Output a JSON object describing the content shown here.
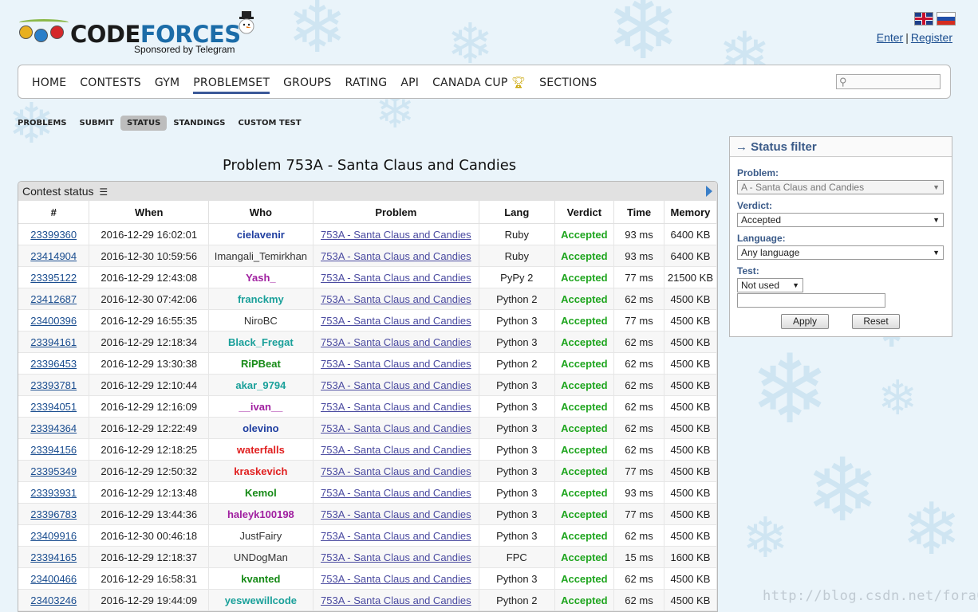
{
  "brand": {
    "wordmark_part1": "CODE",
    "wordmark_part2": "FORCES",
    "sponsor": "Sponsored by Telegram"
  },
  "auth": {
    "enter": "Enter",
    "separator": "|",
    "register": "Register"
  },
  "languages": [
    "english-flag-icon",
    "russian-flag-icon"
  ],
  "main_nav": [
    {
      "label": "HOME"
    },
    {
      "label": "CONTESTS"
    },
    {
      "label": "GYM"
    },
    {
      "label": "PROBLEMSET",
      "active": true
    },
    {
      "label": "GROUPS"
    },
    {
      "label": "RATING"
    },
    {
      "label": "API"
    },
    {
      "label": "CANADA CUP",
      "icon": "trophy-icon"
    },
    {
      "label": "SECTIONS"
    }
  ],
  "search": {
    "icon": "search-icon",
    "value": ""
  },
  "sub_nav": [
    {
      "label": "PROBLEMS"
    },
    {
      "label": "SUBMIT"
    },
    {
      "label": "STATUS",
      "active": true
    },
    {
      "label": "STANDINGS"
    },
    {
      "label": "CUSTOM TEST"
    }
  ],
  "page_title": "Problem 753A - Santa Claus and Candies",
  "status_box": {
    "title": "Contest status",
    "icon": "list-icon",
    "next_icon": "arrow-right-icon",
    "columns": [
      "#",
      "When",
      "Who",
      "Problem",
      "Lang",
      "Verdict",
      "Time",
      "Memory"
    ],
    "rows": [
      {
        "id": "23399360",
        "when": "2016-12-29 16:02:01",
        "who": "cielavenir",
        "who_color": "#1f3ea0",
        "problem": "753A - Santa Claus and Candies",
        "lang": "Ruby",
        "verdict": "Accepted",
        "time": "93 ms",
        "memory": "6400 KB"
      },
      {
        "id": "23414904",
        "when": "2016-12-30 10:59:56",
        "who": "Imangali_Temirkhan",
        "who_color": "#333333",
        "problem": "753A - Santa Claus and Candies",
        "lang": "Ruby",
        "verdict": "Accepted",
        "time": "93 ms",
        "memory": "6400 KB"
      },
      {
        "id": "23395122",
        "when": "2016-12-29 12:43:08",
        "who": "Yash_",
        "who_color": "#a01fa0",
        "problem": "753A - Santa Claus and Candies",
        "lang": "PyPy 2",
        "verdict": "Accepted",
        "time": "77 ms",
        "memory": "21500 KB"
      },
      {
        "id": "23412687",
        "when": "2016-12-30 07:42:06",
        "who": "franckmy",
        "who_color": "#1aa09a",
        "problem": "753A - Santa Claus and Candies",
        "lang": "Python 2",
        "verdict": "Accepted",
        "time": "62 ms",
        "memory": "4500 KB"
      },
      {
        "id": "23400396",
        "when": "2016-12-29 16:55:35",
        "who": "NiroBC",
        "who_color": "#333333",
        "problem": "753A - Santa Claus and Candies",
        "lang": "Python 3",
        "verdict": "Accepted",
        "time": "77 ms",
        "memory": "4500 KB"
      },
      {
        "id": "23394161",
        "when": "2016-12-29 12:18:34",
        "who": "Black_Fregat",
        "who_color": "#1aa09a",
        "problem": "753A - Santa Claus and Candies",
        "lang": "Python 3",
        "verdict": "Accepted",
        "time": "62 ms",
        "memory": "4500 KB"
      },
      {
        "id": "23396453",
        "when": "2016-12-29 13:30:38",
        "who": "RiPBeat",
        "who_color": "#168a16",
        "problem": "753A - Santa Claus and Candies",
        "lang": "Python 2",
        "verdict": "Accepted",
        "time": "62 ms",
        "memory": "4500 KB"
      },
      {
        "id": "23393781",
        "when": "2016-12-29 12:10:44",
        "who": "akar_9794",
        "who_color": "#1aa09a",
        "problem": "753A - Santa Claus and Candies",
        "lang": "Python 3",
        "verdict": "Accepted",
        "time": "62 ms",
        "memory": "4500 KB"
      },
      {
        "id": "23394051",
        "when": "2016-12-29 12:16:09",
        "who": "__ivan__",
        "who_color": "#a01fa0",
        "problem": "753A - Santa Claus and Candies",
        "lang": "Python 3",
        "verdict": "Accepted",
        "time": "62 ms",
        "memory": "4500 KB"
      },
      {
        "id": "23394364",
        "when": "2016-12-29 12:22:49",
        "who": "olevino",
        "who_color": "#1f3ea0",
        "problem": "753A - Santa Claus and Candies",
        "lang": "Python 3",
        "verdict": "Accepted",
        "time": "62 ms",
        "memory": "4500 KB"
      },
      {
        "id": "23394156",
        "when": "2016-12-29 12:18:25",
        "who": "waterfalls",
        "who_color": "#e01f1f",
        "problem": "753A - Santa Claus and Candies",
        "lang": "Python 3",
        "verdict": "Accepted",
        "time": "62 ms",
        "memory": "4500 KB"
      },
      {
        "id": "23395349",
        "when": "2016-12-29 12:50:32",
        "who": "kraskevich",
        "who_color": "#e01f1f",
        "problem": "753A - Santa Claus and Candies",
        "lang": "Python 3",
        "verdict": "Accepted",
        "time": "77 ms",
        "memory": "4500 KB"
      },
      {
        "id": "23393931",
        "when": "2016-12-29 12:13:48",
        "who": "Kemol",
        "who_color": "#168a16",
        "problem": "753A - Santa Claus and Candies",
        "lang": "Python 3",
        "verdict": "Accepted",
        "time": "93 ms",
        "memory": "4500 KB"
      },
      {
        "id": "23396783",
        "when": "2016-12-29 13:44:36",
        "who": "haleyk100198",
        "who_color": "#a01fa0",
        "problem": "753A - Santa Claus and Candies",
        "lang": "Python 3",
        "verdict": "Accepted",
        "time": "77 ms",
        "memory": "4500 KB"
      },
      {
        "id": "23409916",
        "when": "2016-12-30 00:46:18",
        "who": "JustFairy",
        "who_color": "#333333",
        "problem": "753A - Santa Claus and Candies",
        "lang": "Python 3",
        "verdict": "Accepted",
        "time": "62 ms",
        "memory": "4500 KB"
      },
      {
        "id": "23394165",
        "when": "2016-12-29 12:18:37",
        "who": "UNDogMan",
        "who_color": "#333333",
        "problem": "753A - Santa Claus and Candies",
        "lang": "FPC",
        "verdict": "Accepted",
        "time": "15 ms",
        "memory": "1600 KB"
      },
      {
        "id": "23400466",
        "when": "2016-12-29 16:58:31",
        "who": "kvanted",
        "who_color": "#168a16",
        "problem": "753A - Santa Claus and Candies",
        "lang": "Python 3",
        "verdict": "Accepted",
        "time": "62 ms",
        "memory": "4500 KB"
      },
      {
        "id": "23403246",
        "when": "2016-12-29 19:44:09",
        "who": "yeswewillcode",
        "who_color": "#1aa09a",
        "problem": "753A - Santa Claus and Candies",
        "lang": "Python 2",
        "verdict": "Accepted",
        "time": "62 ms",
        "memory": "4500 KB"
      }
    ]
  },
  "filter": {
    "title": "→ Status filter",
    "problem_label": "Problem:",
    "problem_value": "A - Santa Claus and Candies",
    "verdict_label": "Verdict:",
    "verdict_value": "Accepted",
    "language_label": "Language:",
    "language_value": "Any language",
    "test_label": "Test:",
    "test_value": "Not used",
    "test_number": "",
    "apply": "Apply",
    "reset": "Reset"
  },
  "watermark": "http://blog.csdn.net/fora0"
}
